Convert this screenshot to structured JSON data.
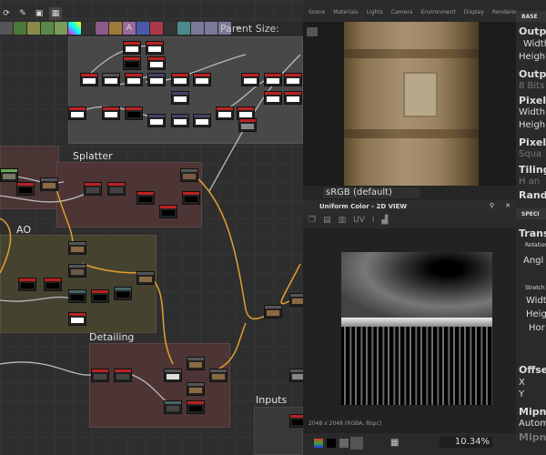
{
  "toolbar": {
    "parent_size_label": "Parent Size:",
    "more": "»"
  },
  "graph": {
    "frames": {
      "splatter": "Splatter",
      "ao": "AO",
      "detailing": "Detailing",
      "inputs": "Inputs"
    }
  },
  "view3d": {
    "tabs": [
      "Scene",
      "Materials",
      "Lights",
      "Camera",
      "Environment",
      "Display",
      "Renderer"
    ],
    "colorspace": "sRGB (default)"
  },
  "view2d": {
    "title": "Uniform Color - 2D VIEW",
    "uv": "UV",
    "info": "2048 x 2048 (RGBA, 8bpc)",
    "zoom": "10.34%"
  },
  "props": {
    "section1": "BASE",
    "section2": "SPECI",
    "items": [
      "Outp",
      "Width",
      "Heigh",
      "Outp",
      "8 Bits",
      "Pixel",
      "Width",
      "Heigh",
      "Pixel",
      "Squa",
      "Tiling",
      "H an",
      "Rand",
      "Trans",
      "Rotation",
      "Angl",
      "Stretch",
      "Widt",
      "Heig",
      "Hor",
      "Offse",
      "X",
      "Y",
      "Mipn",
      "Autom",
      "Mipn"
    ]
  }
}
